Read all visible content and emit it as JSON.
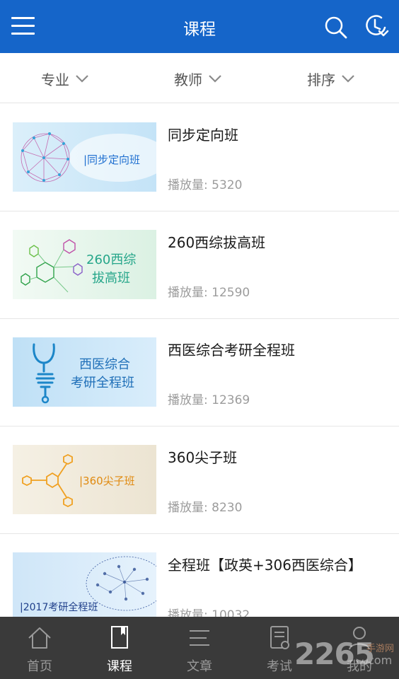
{
  "header": {
    "title": "课程",
    "menu_icon": "hamburger-menu-icon",
    "search_icon": "search-icon",
    "history_icon": "history-clock-icon",
    "color": "#1565c9"
  },
  "filters": [
    {
      "label": "专业",
      "icon": "chevron-down-icon"
    },
    {
      "label": "教师",
      "icon": "chevron-down-icon"
    },
    {
      "label": "排序",
      "icon": "chevron-down-icon"
    }
  ],
  "courses": [
    {
      "title": "同步定向班",
      "plays": "播放量: 5320",
      "thumb_text": [
        "|同步定向班"
      ]
    },
    {
      "title": "260西综拔高班",
      "plays": "播放量: 12590",
      "thumb_text": [
        "260西综",
        "拔高班"
      ]
    },
    {
      "title": "西医综合考研全程班",
      "plays": "播放量: 12369",
      "thumb_text": [
        "西医综合",
        "考研全程班"
      ]
    },
    {
      "title": "360尖子班",
      "plays": "播放量: 8230",
      "thumb_text": [
        "|360尖子班"
      ]
    },
    {
      "title": "全程班【政英+306西医综合】",
      "plays": "播放量: 10032",
      "thumb_text": [
        "|2017考研全程班"
      ]
    }
  ],
  "tabbar": {
    "tabs": [
      {
        "label": "首页",
        "icon": "home-icon"
      },
      {
        "label": "课程",
        "icon": "book-icon",
        "active": true
      },
      {
        "label": "文章",
        "icon": "article-lines-icon"
      },
      {
        "label": "考试",
        "icon": "exam-document-icon"
      },
      {
        "label": "我的",
        "icon": "profile-person-icon"
      }
    ]
  },
  "watermark": {
    "big": "2265",
    "small": "手游网",
    "suffix": "com"
  }
}
